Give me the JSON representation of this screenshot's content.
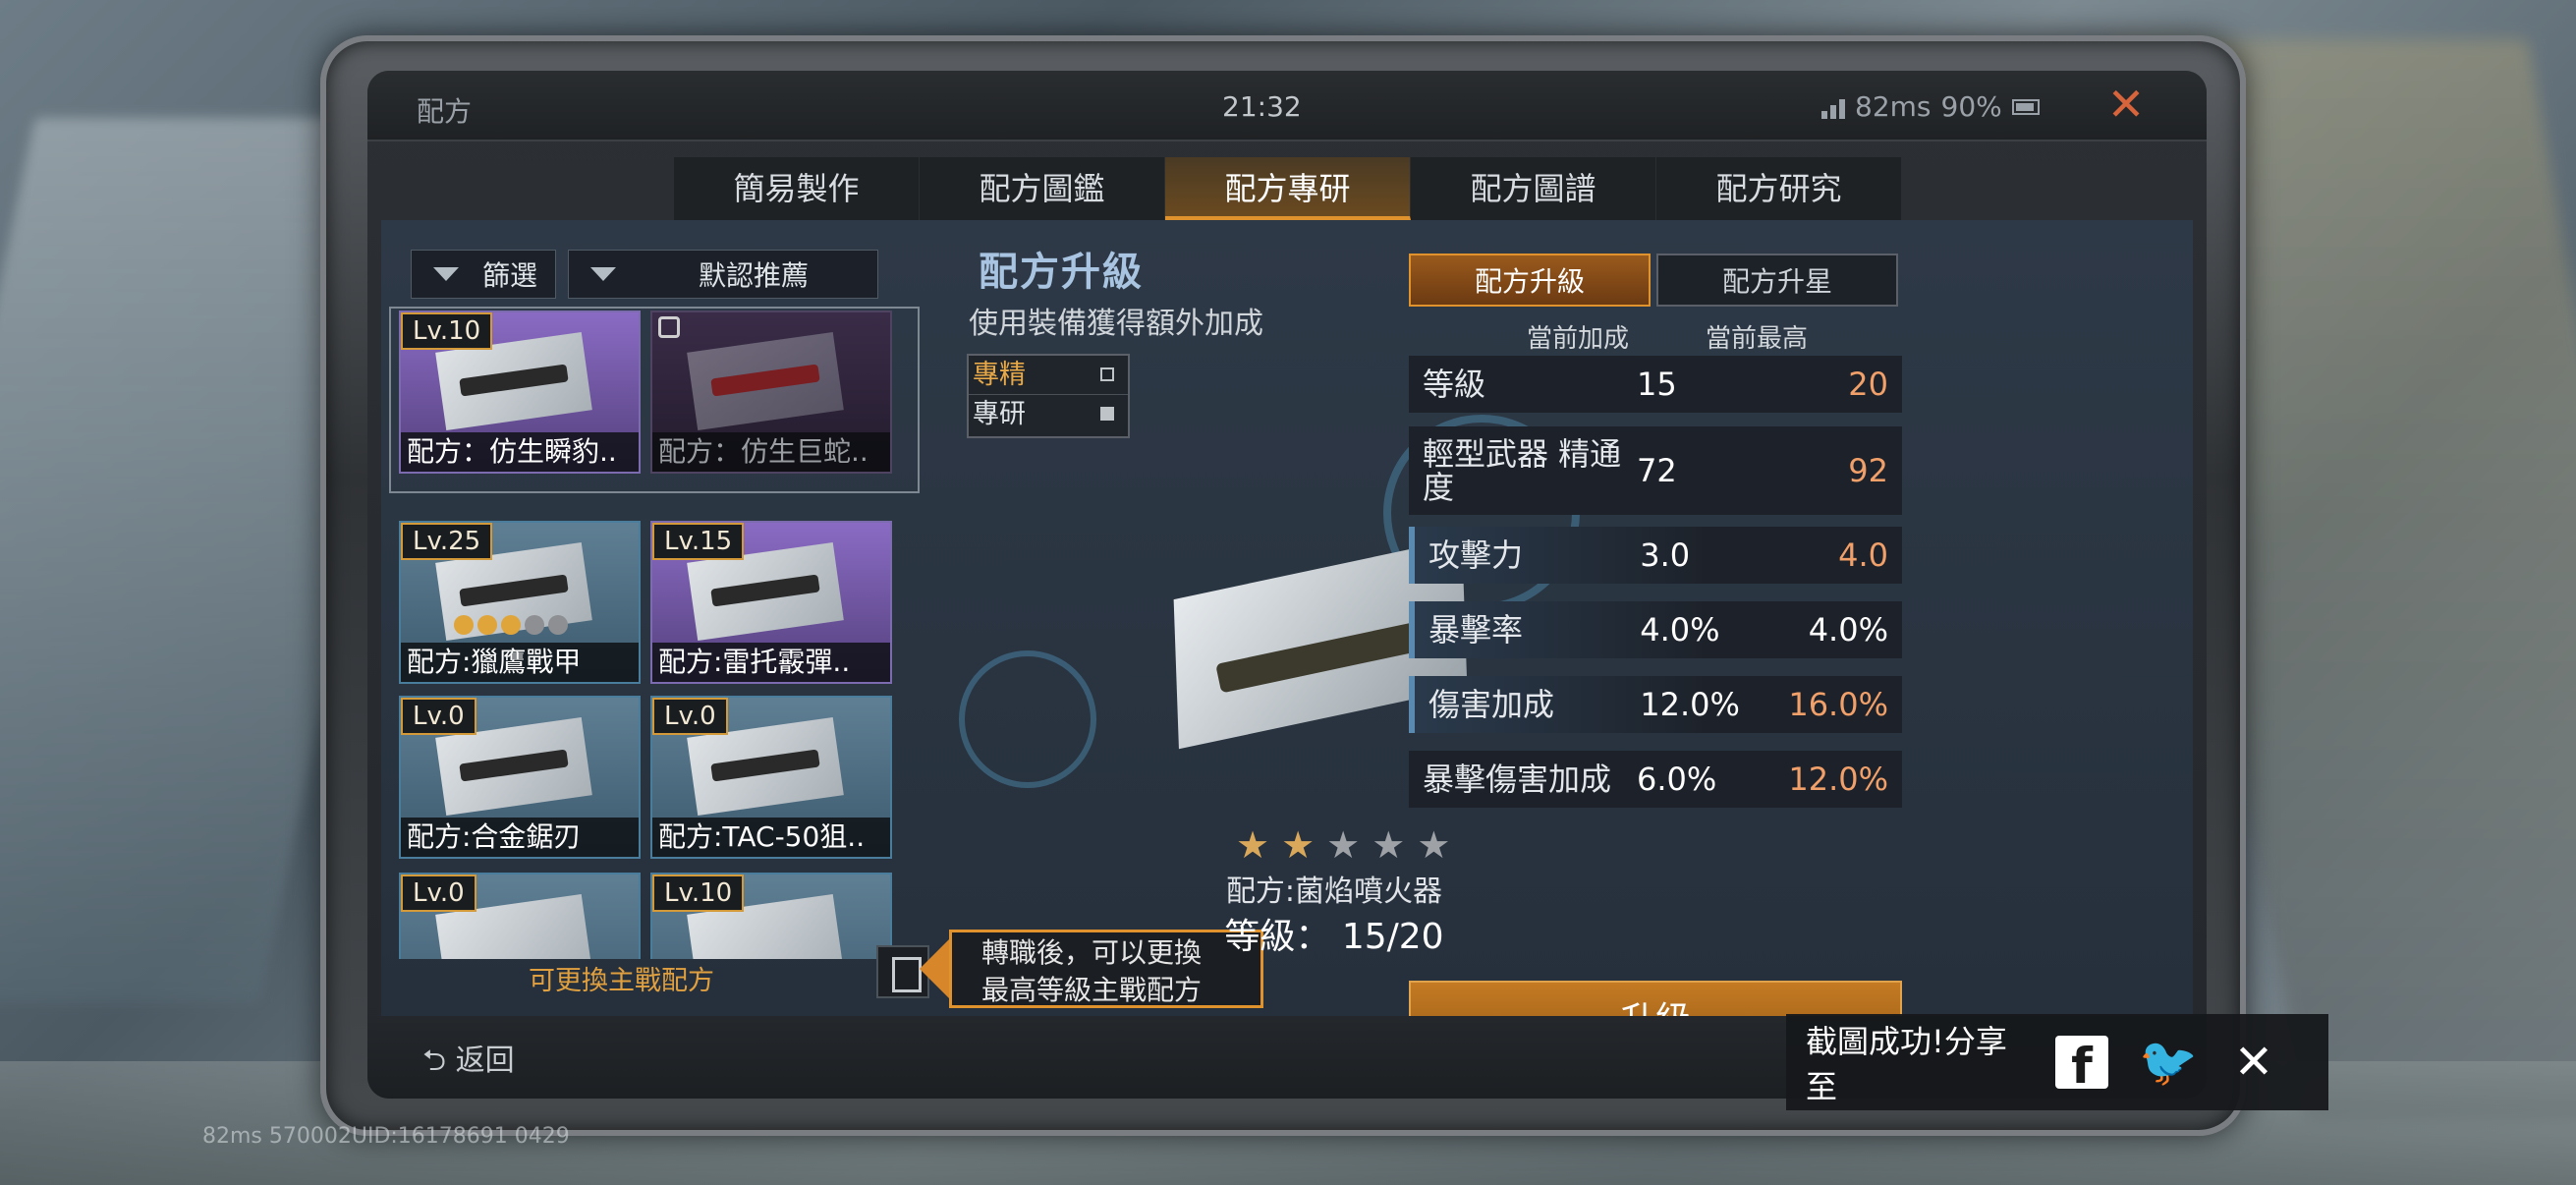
{
  "window": {
    "title": "配方",
    "clock": "21:32",
    "ping": "82ms",
    "battery": "90%"
  },
  "tabs": [
    "簡易製作",
    "配方圖鑑",
    "配方專研",
    "配方圖譜",
    "配方研究"
  ],
  "active_tab": "配方專研",
  "left": {
    "filter_label": "篩選",
    "sort_label": "默認推薦",
    "cards": [
      {
        "level": "Lv.10",
        "name": "配方：仿生瞬豹..",
        "style": "purple"
      },
      {
        "level": "",
        "name": "配方：仿生巨蛇..",
        "style": "dark",
        "locked": true
      },
      {
        "level": "Lv.25",
        "name": "配方:獵鷹戰甲",
        "style": "blue"
      },
      {
        "level": "Lv.15",
        "name": "配方:雷托霰彈..",
        "style": "purple"
      },
      {
        "level": "Lv.0",
        "name": "配方:合金鋸刃",
        "style": "blue"
      },
      {
        "level": "Lv.0",
        "name": "配方:TAC-50狙..",
        "style": "blue"
      },
      {
        "level": "Lv.0",
        "name": "",
        "style": "blue"
      },
      {
        "level": "Lv.10",
        "name": "",
        "style": "blue"
      }
    ],
    "switch_hint": "可更換主戰配方",
    "tooltip_line1": "轉職後，可以更換",
    "tooltip_line2": "最高等級主戰配方"
  },
  "middle": {
    "title": "配方升級",
    "subtitle": "使用裝備獲得額外加成",
    "legend": [
      {
        "label": "專精"
      },
      {
        "label": "專研"
      }
    ],
    "recipe_name": "配方:菌焰噴火器",
    "level_label": "等級： 15/20",
    "stars_filled": 2,
    "stars_total": 5
  },
  "right": {
    "tab_upgrade": "配方升級",
    "tab_star": "配方升星",
    "col_current": "當前加成",
    "col_max": "當前最高",
    "stats": [
      {
        "label": "等級",
        "current": "15",
        "max": "20",
        "max_highlight": true,
        "hl": false
      },
      {
        "label": "輕型武器 精通度",
        "current": "72",
        "max": "92",
        "max_highlight": true,
        "hl": false
      },
      {
        "label": "攻擊力",
        "current": "3.0",
        "max": "4.0",
        "max_highlight": true,
        "hl": true
      },
      {
        "label": "暴擊率",
        "current": "4.0%",
        "max": "4.0%",
        "max_highlight": false,
        "hl": true
      },
      {
        "label": "傷害加成",
        "current": "12.0%",
        "max": "16.0%",
        "max_highlight": true,
        "hl": true
      },
      {
        "label": "暴擊傷害加成",
        "current": "6.0%",
        "max": "12.0%",
        "max_highlight": true,
        "hl": false
      }
    ],
    "upgrade_button": "升級"
  },
  "bottom": {
    "back_label": "返回"
  },
  "share": {
    "text": "截圖成功!分享至",
    "fb_icon": "facebook-icon",
    "tw_icon": "twitter-icon"
  },
  "debug_text": "82ms  570002UID:16178691 0429",
  "colors": {
    "accent": "#e0922c",
    "highlight_value": "#f1a06a"
  }
}
